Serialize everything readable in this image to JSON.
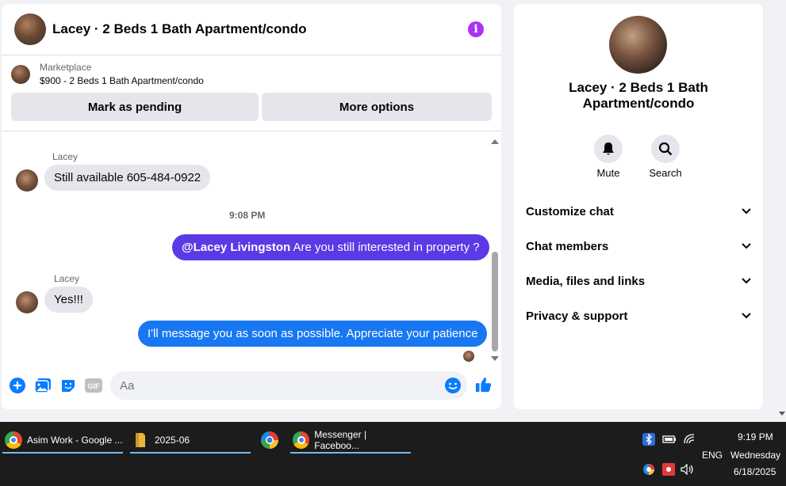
{
  "chat": {
    "title": "Lacey · 2 Beds 1 Bath Apartment/condo",
    "marketplace_label": "Marketplace",
    "listing": "$900 - 2 Beds 1 Bath Apartment/condo",
    "mark_pending": "Mark as pending",
    "more_options": "More options",
    "messages": [
      {
        "sender": "Lacey",
        "text": "Still available 605-484-0922"
      },
      {
        "time": "9:08 PM"
      },
      {
        "mention": "@Lacey Livingston",
        "text": " Are you still interested in property ?"
      },
      {
        "sender": "Lacey",
        "text": "Yes!!!"
      },
      {
        "text": "I'll message you as soon as possible. Appreciate your patience"
      }
    ],
    "input_placeholder": "Aa",
    "colors": {
      "accent_purple": "#5b3ae6",
      "accent_blue": "#1877f2",
      "info": "#a933f5"
    }
  },
  "side": {
    "title": "Lacey · 2 Beds 1 Bath Apartment/condo",
    "mute": "Mute",
    "search": "Search",
    "items": [
      "Customize chat",
      "Chat members",
      "Media, files and links",
      "Privacy & support"
    ]
  },
  "taskbar": {
    "apps": [
      {
        "label": "Asim Work - Google ...",
        "icon": "chrome-icon"
      },
      {
        "label": "2025-06",
        "icon": "folder-icon"
      },
      {
        "label": "",
        "icon": "edge-icon"
      },
      {
        "label": "Messenger | Faceboo...",
        "icon": "chrome-icon"
      }
    ],
    "lang": "ENG",
    "time": "9:19 PM",
    "day": "Wednesday",
    "date": "6/18/2025"
  }
}
